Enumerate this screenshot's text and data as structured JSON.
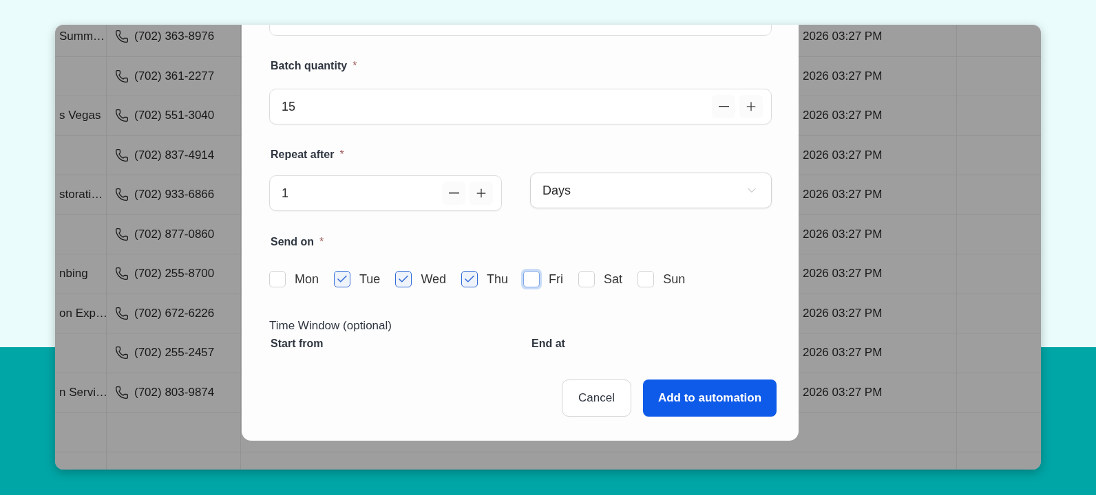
{
  "table": {
    "rows": [
      {
        "name": "Summ…",
        "phone": "(702) 363-8976",
        "created": "2026 03:27 PM"
      },
      {
        "phone": "(702) 361-2277",
        "created": "2026 03:27 PM"
      },
      {
        "name": "s Vegas",
        "phone": "(702) 551-3040",
        "created": "2026 03:27 PM"
      },
      {
        "phone": "(702) 837-4914",
        "created": "2026 03:27 PM"
      },
      {
        "name": "storati…",
        "phone": "(702) 933-6866",
        "created": "2026 03:27 PM"
      },
      {
        "phone": "(702) 877-0860",
        "created": "2026 03:27 PM"
      },
      {
        "name": "nbing",
        "phone": "(702) 255-8700",
        "created": "2026 03:27 PM"
      },
      {
        "name": "on Exp…",
        "phone": "(702) 672-6226",
        "created": "2026 03:27 PM"
      },
      {
        "phone": "(702) 255-2457",
        "created": "2026 03:27 PM"
      },
      {
        "name": "n Servi…",
        "phone": "(702) 803-9874",
        "created": "2026 03:27 PM"
      }
    ]
  },
  "modal": {
    "batch_quantity": {
      "label": "Batch quantity",
      "required_mark": "*",
      "value": "15"
    },
    "repeat_after": {
      "label": "Repeat after",
      "required_mark": "*",
      "value": "1",
      "unit": "Days"
    },
    "send_on": {
      "label": "Send on",
      "required_mark": "*",
      "days": [
        {
          "label": "Mon",
          "checked": false,
          "focused": false
        },
        {
          "label": "Tue",
          "checked": true,
          "focused": false
        },
        {
          "label": "Wed",
          "checked": true,
          "focused": false
        },
        {
          "label": "Thu",
          "checked": true,
          "focused": false
        },
        {
          "label": "Fri",
          "checked": false,
          "focused": true
        },
        {
          "label": "Sat",
          "checked": false,
          "focused": false
        },
        {
          "label": "Sun",
          "checked": false,
          "focused": false
        }
      ]
    },
    "time_window": {
      "title": "Time Window (optional)",
      "start_label": "Start from",
      "end_label": "End at"
    },
    "buttons": {
      "cancel": "Cancel",
      "submit": "Add to automation"
    }
  }
}
